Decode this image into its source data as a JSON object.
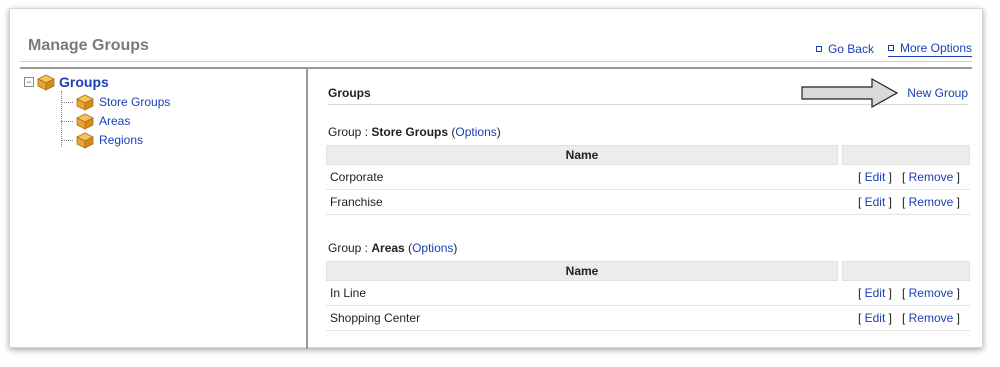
{
  "header": {
    "title": "Manage Groups",
    "go_back": "Go Back",
    "more_options": "More Options"
  },
  "tree": {
    "root": "Groups",
    "children": [
      "Store Groups",
      "Areas",
      "Regions"
    ]
  },
  "main": {
    "section_title": "Groups",
    "new_group": "New Group",
    "groups": [
      {
        "prefix": "Group : ",
        "name": "Store Groups",
        "options": "Options",
        "column": "Name",
        "rows": [
          "Corporate",
          "Franchise"
        ]
      },
      {
        "prefix": "Group : ",
        "name": "Areas",
        "options": "Options",
        "column": "Name",
        "rows": [
          "In Line",
          "Shopping Center"
        ]
      }
    ],
    "edit_label": "Edit",
    "remove_label": "Remove"
  },
  "colors": {
    "link": "#1a3fb5",
    "title_gray": "#7a7a7a",
    "header_fill": "#ececec",
    "box_icon": "#e8a531"
  }
}
